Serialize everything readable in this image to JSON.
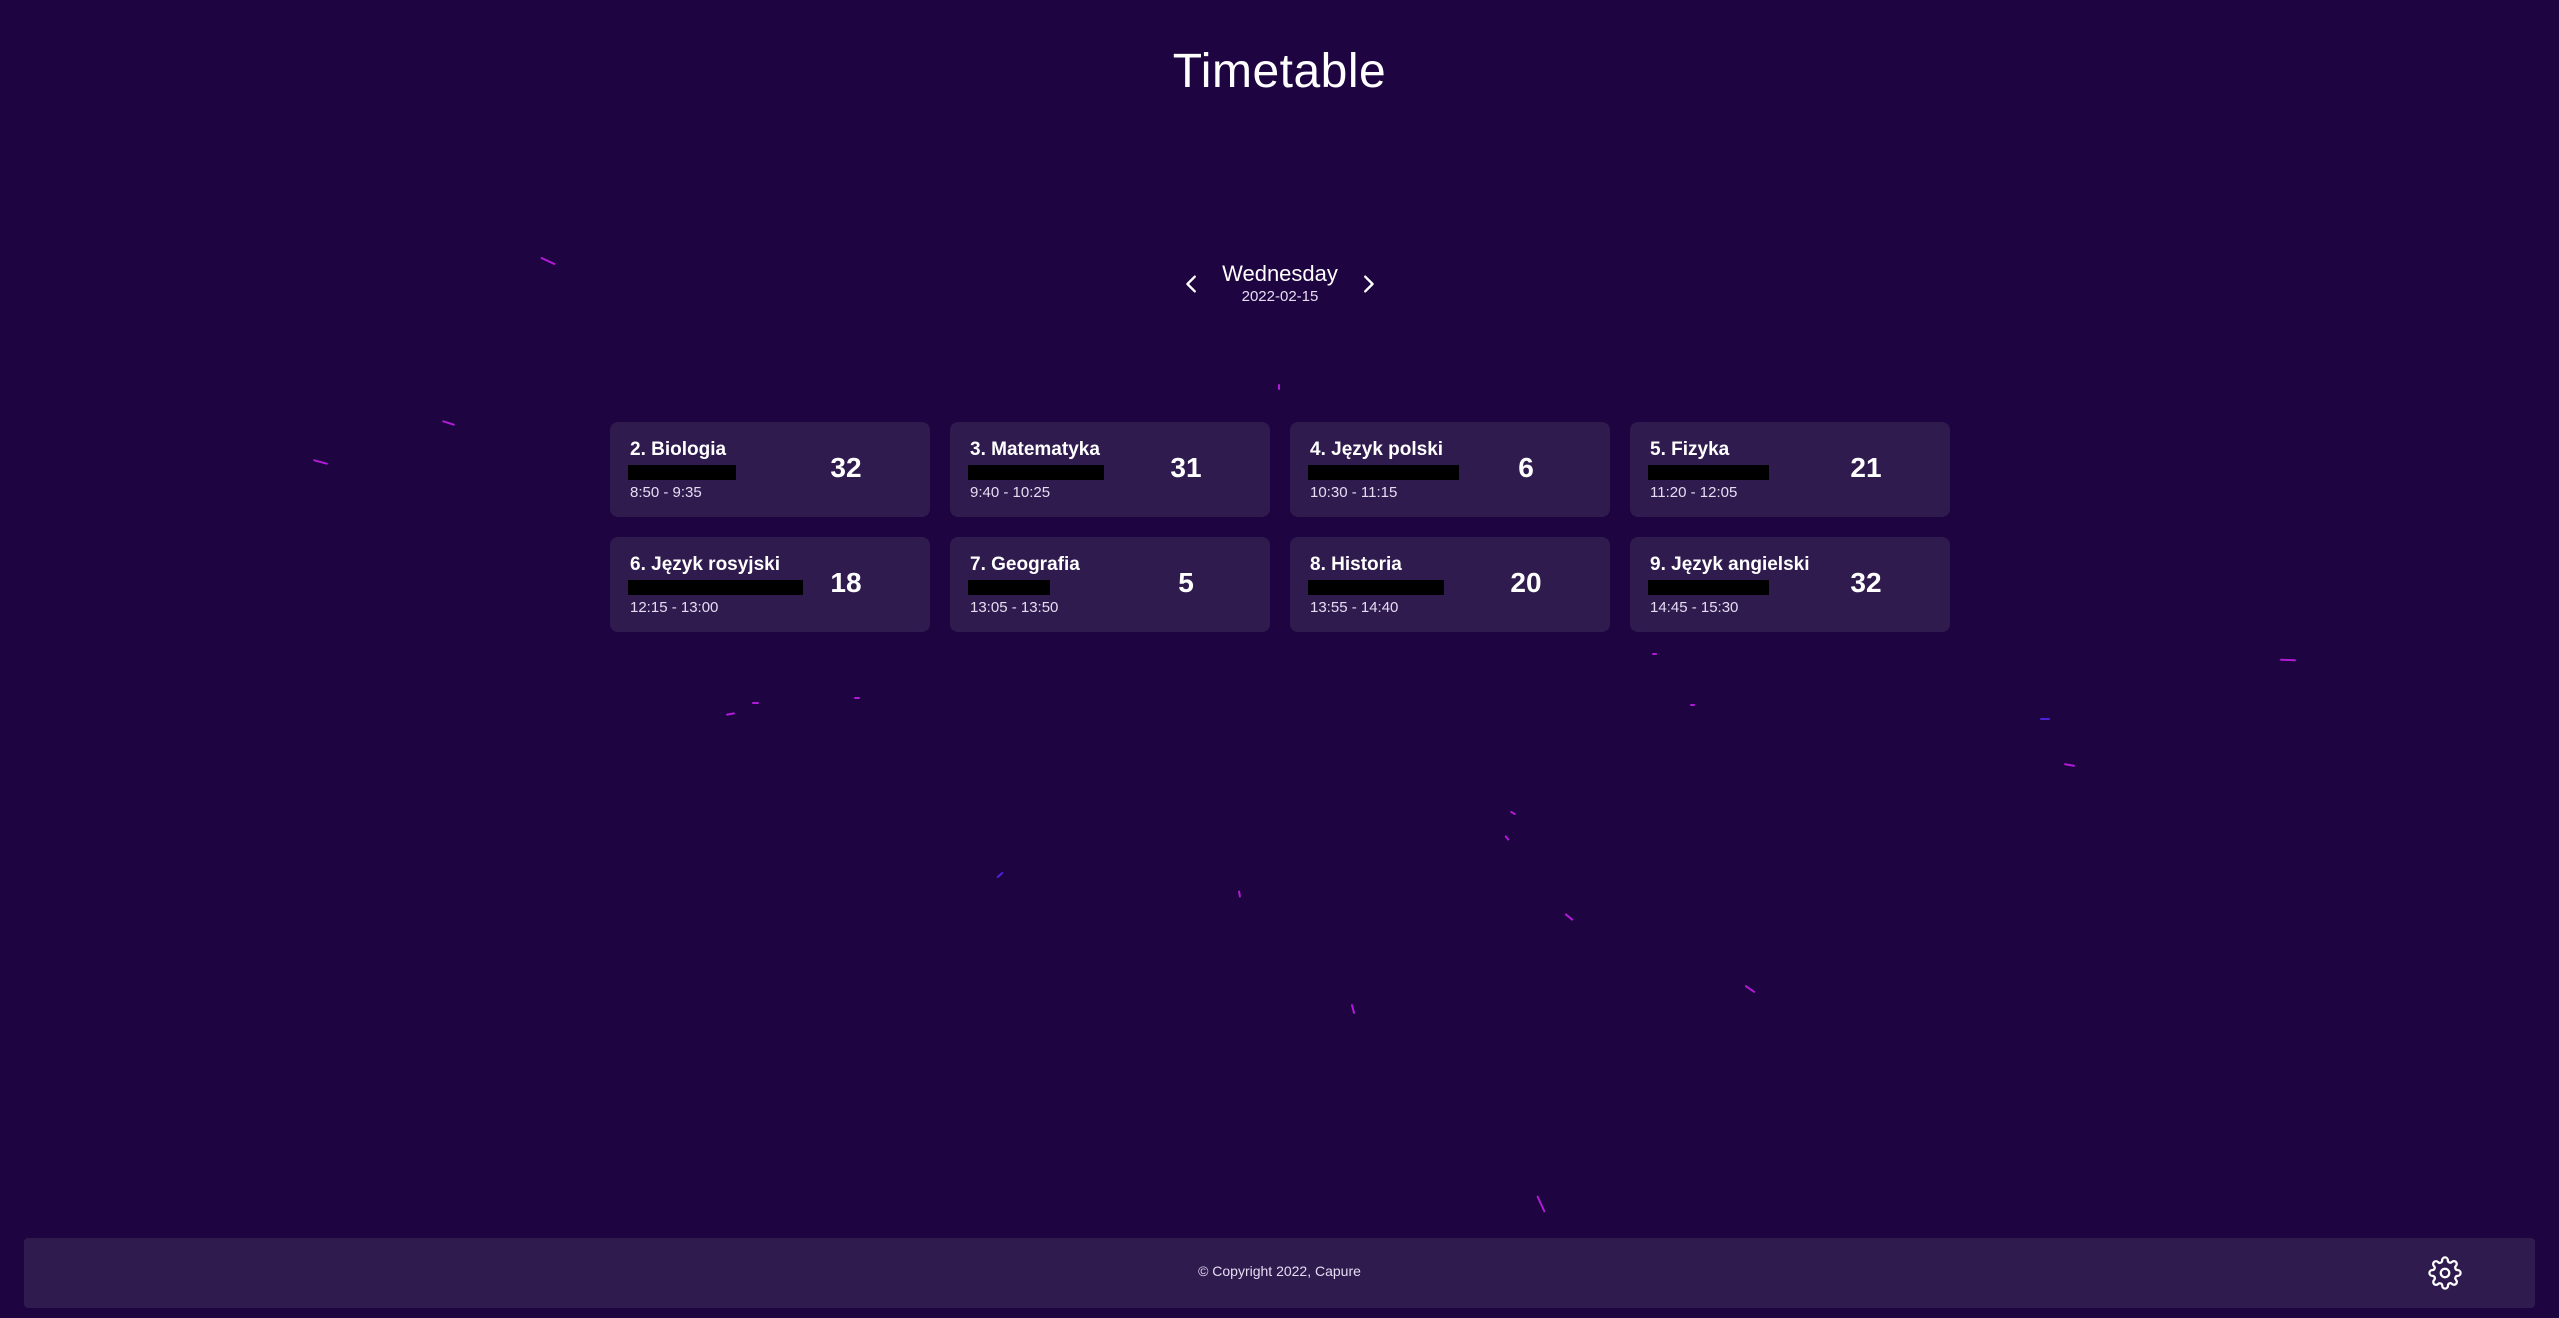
{
  "page": {
    "title": "Timetable"
  },
  "day_nav": {
    "prev_icon": "chevron-left-icon",
    "next_icon": "chevron-right-icon",
    "day_name": "Wednesday",
    "date": "2022-02-15"
  },
  "lessons": [
    {
      "title": "2. Biologia",
      "time": "8:50 - 9:35",
      "room": "32"
    },
    {
      "title": "3. Matematyka",
      "time": "9:40 - 10:25",
      "room": "31"
    },
    {
      "title": "4. Język polski",
      "time": "10:30 - 11:15",
      "room": "6"
    },
    {
      "title": "5. Fizyka",
      "time": "11:20 - 12:05",
      "room": "21"
    },
    {
      "title": "6. Język rosyjski",
      "time": "12:15 - 13:00",
      "room": "18"
    },
    {
      "title": "7. Geografia",
      "time": "13:05 - 13:50",
      "room": "5"
    },
    {
      "title": "8. Historia",
      "time": "13:55 - 14:40",
      "room": "20"
    },
    {
      "title": "9. Język angielski",
      "time": "14:45 - 15:30",
      "room": "32"
    }
  ],
  "footer": {
    "copyright": "© Copyright 2022, Capure",
    "settings_icon": "gear-icon"
  },
  "colors": {
    "background": "#1e0440",
    "card": "#2f1b4e",
    "text": "#ffffff",
    "streak_magenta": "#b21bd6",
    "streak_blue": "#4a22d8"
  }
}
